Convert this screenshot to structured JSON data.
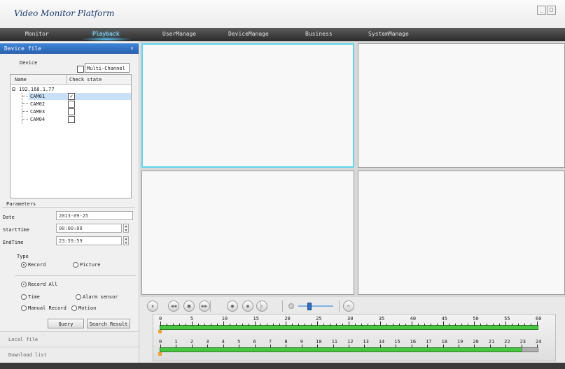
{
  "app": {
    "title": "Video Monitor Platform",
    "win_min": "_",
    "win_max": "□"
  },
  "menu": [
    {
      "label": "Monitor",
      "active": false
    },
    {
      "label": "Playback",
      "active": true
    },
    {
      "label": "UserManage",
      "active": false
    },
    {
      "label": "DeviceManage",
      "active": false
    },
    {
      "label": "Business",
      "active": false
    },
    {
      "label": "SystemManage",
      "active": false
    }
  ],
  "sidebar": {
    "device_file": {
      "title": "Device file",
      "arrow": "›"
    },
    "device_label": "Device",
    "multi_channel": {
      "label": "Multi-Channel",
      "checked": false
    },
    "table": {
      "headers": [
        "Name",
        "Check state"
      ],
      "root": {
        "expander": "⊟",
        "label": "192.168.1.77"
      },
      "cameras": [
        {
          "name": "CAM01",
          "checked": true,
          "selected": true
        },
        {
          "name": "CAM02",
          "checked": false,
          "selected": false
        },
        {
          "name": "CAM03",
          "checked": false,
          "selected": false
        },
        {
          "name": "CAM04",
          "checked": false,
          "selected": false
        }
      ]
    },
    "parameters": {
      "title": "Parameters",
      "date_label": "Date",
      "date_value": "2013-09-25",
      "start_label": "StartTime",
      "start_value": "00:00:00",
      "end_label": "EndTime",
      "end_value": "23:59:59"
    },
    "type": {
      "title": "Type",
      "options": [
        {
          "label": "Record",
          "selected": true
        },
        {
          "label": "Picture",
          "selected": false
        }
      ]
    },
    "record": {
      "options": [
        {
          "label": "Record All",
          "selected": true
        },
        {
          "label": "Time",
          "selected": false
        },
        {
          "label": "Alarm sensor",
          "selected": false
        },
        {
          "label": "Manual Record",
          "selected": false
        },
        {
          "label": "Motion",
          "selected": false
        }
      ]
    },
    "buttons": {
      "query": "Query",
      "search_result": "Search Result"
    },
    "tabs": {
      "local_file": "Local file",
      "download_list": "Download list"
    }
  },
  "playback": {
    "controls": [
      {
        "name": "pause-button",
        "glyph": "⏸"
      },
      {
        "name": "rewind-button",
        "glyph": "◀◀"
      },
      {
        "name": "stop-button",
        "glyph": "■"
      },
      {
        "name": "fast-forward-button",
        "glyph": "▶▶"
      },
      {
        "name": "record-button",
        "glyph": "●"
      },
      {
        "name": "snapshot-button",
        "glyph": "◉"
      },
      {
        "name": "export-button",
        "glyph": "⇪"
      }
    ],
    "volume": 0.25,
    "extra_icon": "✂"
  },
  "timeline": {
    "minutes": [
      "0",
      "5",
      "10",
      "15",
      "20",
      "25",
      "30",
      "35",
      "40",
      "45",
      "50",
      "55",
      "60"
    ],
    "hours": [
      "0",
      "1",
      "2",
      "3",
      "4",
      "5",
      "6",
      "7",
      "8",
      "9",
      "10",
      "11",
      "12",
      "13",
      "14",
      "15",
      "16",
      "17",
      "18",
      "19",
      "20",
      "21",
      "22",
      "23",
      "24"
    ],
    "hour_recorded_until": 23
  }
}
